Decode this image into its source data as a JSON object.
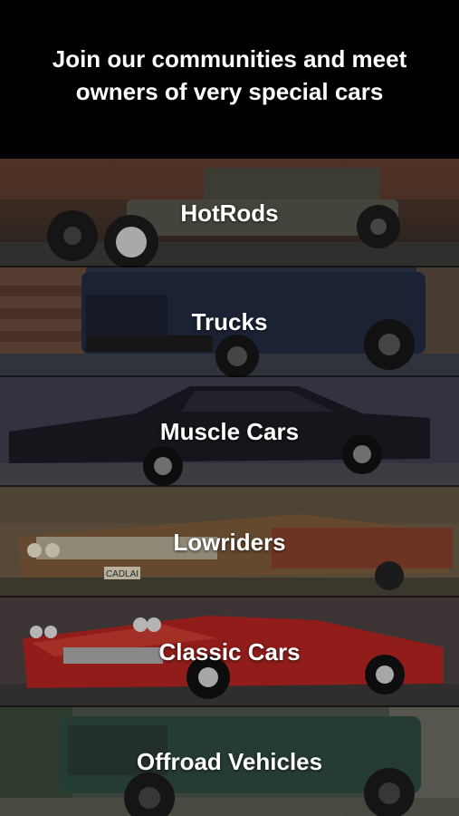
{
  "header": {
    "title": "Join our communities and meet owners of very special cars"
  },
  "categories": [
    {
      "label": "HotRods"
    },
    {
      "label": "Trucks"
    },
    {
      "label": "Muscle Cars"
    },
    {
      "label": "Lowriders"
    },
    {
      "label": "Classic Cars"
    },
    {
      "label": "Offroad Vehicles"
    }
  ],
  "colors": {
    "hotrods_bg": "#4a3a30",
    "trucks_bg": "#2c3348",
    "muscle_bg": "#3a3a4a",
    "lowriders_bg": "#6a5038",
    "classic_bg": "#7a2a28",
    "offroad_bg": "#3e5448"
  },
  "plate_text": "CADLAI"
}
